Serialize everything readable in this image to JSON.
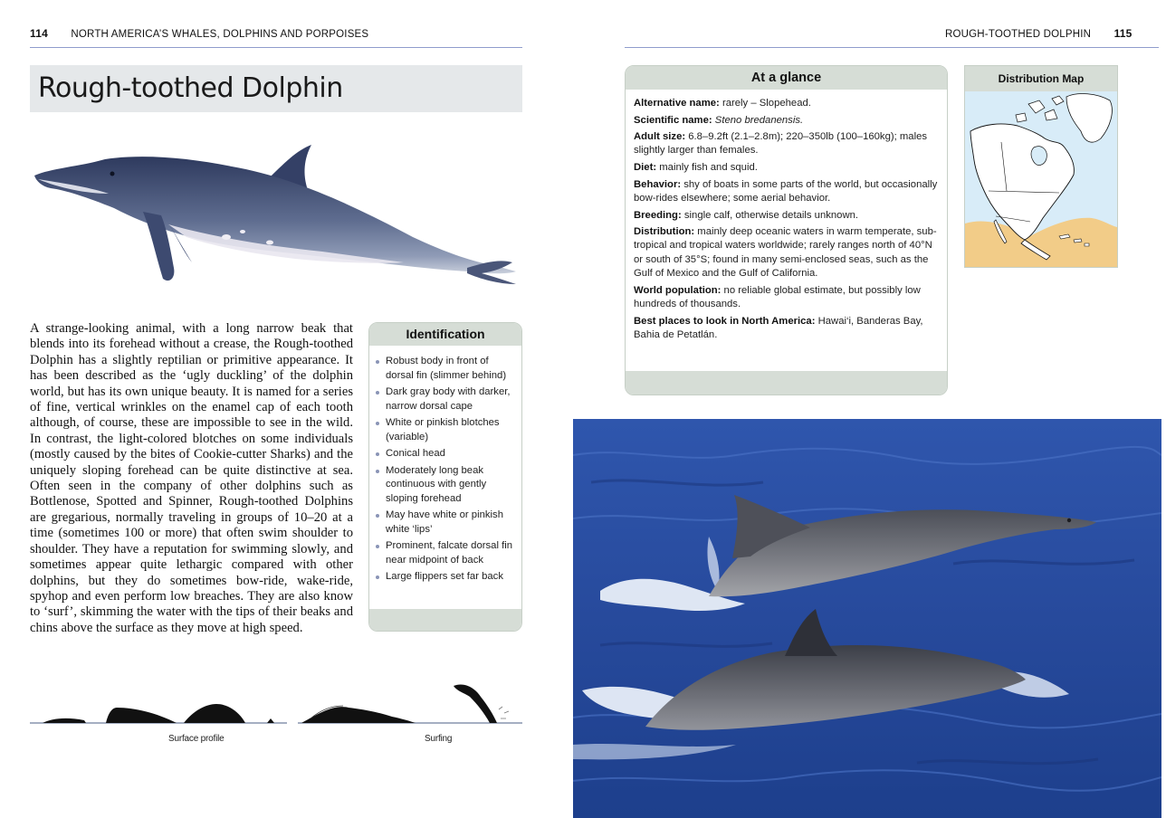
{
  "left_page": {
    "page_number": "114",
    "running_head": "NORTH AMERICA’S WHALES, DOLPHINS AND PORPOISES"
  },
  "right_page": {
    "page_number": "115",
    "running_head": "ROUGH-TOOTHED DOLPHIN"
  },
  "title": "Rough-toothed Dolphin",
  "body_text": "A strange-looking animal, with a long narrow beak that blends into its forehead without a crease, the Rough-toothed Dolphin has a slightly reptilian or primitive appearance. It has been described as the ‘ugly duckling’ of the dolphin world, but has its own unique beauty. It is named for a series of fine, vertical wrinkles on the enamel cap of each tooth although, of course, these are impossible to see in the wild. In contrast, the light-colored blotches on some individuals (mostly caused by the bites of Cookie-cutter Sharks) and the uniquely sloping forehead can be quite distinctive at sea. Often seen in the company of other dolphins such as Bottlenose, Spotted and Spinner, Rough-toothed Dolphins are gregarious, normally traveling in groups of 10–20 at a time (sometimes 100 or more) that often swim shoulder to shoulder. They have a reputation for swimming slowly, and sometimes appear quite lethargic compared with other dolphins, but they do sometimes bow-ride, wake-ride, spyhop and even perform low breaches. They are also know to ‘surf’, skimming the water with the tips of their beaks and chins above the surface as they move at high speed.",
  "identification": {
    "heading": "Identification",
    "items": [
      "Robust body in front of dorsal fin (slimmer behind)",
      "Dark gray body with darker, narrow dorsal cape",
      "White or pinkish blotches (variable)",
      "Conical head",
      "Moderately long beak continuous with gently sloping forehead",
      "May have white or pinkish white ‘lips’",
      "Prominent, falcate dorsal fin near midpoint of back",
      "Large flippers set far back"
    ]
  },
  "at_a_glance": {
    "heading": "At a glance",
    "entries": [
      {
        "label": "Alternative name:",
        "value": " rarely – Slopehead."
      },
      {
        "label": "Scientific name:",
        "value": " Steno bredanensis."
      },
      {
        "label": "Adult size:",
        "value": " 6.8–9.2ft (2.1–2.8m); 220–350lb (100–160kg); males slightly larger than females."
      },
      {
        "label": "Diet:",
        "value": " mainly fish and squid."
      },
      {
        "label": "Behavior:",
        "value": " shy of boats in some parts of the world, but occasionally bow-rides elsewhere; some aerial behavior."
      },
      {
        "label": "Breeding:",
        "value": " single calf, otherwise details unknown."
      },
      {
        "label": "Distribution:",
        "value": " mainly deep oceanic waters in warm temperate, sub-tropical and tropical waters worldwide; rarely ranges north of 40°N or south of 35°S; found in many semi-enclosed seas, such as the Gulf of Mexico and the Gulf of California."
      },
      {
        "label": "World population:",
        "value": " no reliable global estimate, but possibly low hundreds of thousands."
      },
      {
        "label": "Best places to look in North America:",
        "value": " Hawai‘i, Banderas Bay, Bahia de Petatlán."
      }
    ]
  },
  "distribution_map": {
    "heading": "Distribution Map"
  },
  "captions": {
    "surface_profile": "Surface profile",
    "surfing": "Surfing"
  },
  "colors": {
    "rule": "#8f9ccc",
    "panel_header": "#d6ddd6",
    "title_band": "#e5e8ea",
    "map_ocean": "#d8ecf8",
    "map_range": "#f2cc88",
    "sea": "#2a4fa6"
  }
}
